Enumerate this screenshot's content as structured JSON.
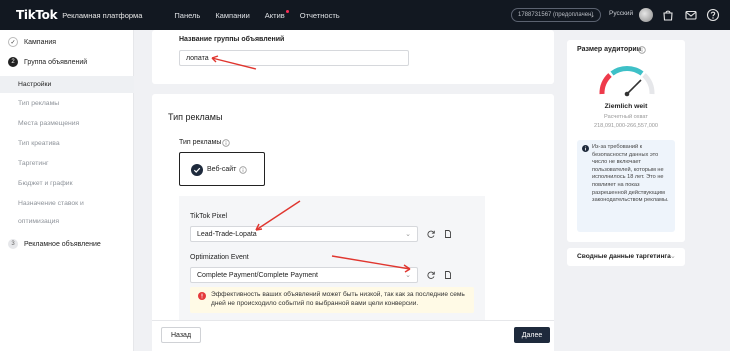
{
  "topbar": {
    "logo": "TikTok",
    "logo_sub": "Рекламная платформа",
    "nav": [
      "Панель",
      "Кампании",
      "Актив",
      "Отчетность"
    ],
    "account": "1788731567 (предоплачен)",
    "language": "Русский",
    "icons": [
      "avatar",
      "store-icon",
      "mail-icon",
      "help-icon"
    ]
  },
  "sidebar": {
    "campaign": "Кампания",
    "step2_num": "2",
    "ad_group": "Группа объявлений",
    "sub_items": [
      "Настройки",
      "Тип рекламы",
      "Места размещения",
      "Тип креатива",
      "Таргетинг",
      "Бюджет и график",
      "Назначение ставок и",
      "оптимизация"
    ],
    "step3_num": "3",
    "ad": "Рекламное объявление"
  },
  "name_section": {
    "label": "Название группы объявлений",
    "value": "лопата"
  },
  "ad_type_section": {
    "title": "Тип рекламы",
    "label": "Тип рекламы",
    "option": "Веб-сайт",
    "pixel_label": "TikTok Pixel",
    "pixel_value": "Lead-Trade-Lopata",
    "event_label": "Optimization Event",
    "event_value": "Complete Payment/Complete Payment",
    "warning": "Эффективность ваших объявлений может быть низкой, так как за последние семь дней не происходило событий по выбранной вами цели конверсии."
  },
  "footer": {
    "back": "Назад",
    "next": "Далее"
  },
  "audience": {
    "title": "Размер аудитории",
    "gauge_label": "Ziemlich weit",
    "estimate_label": "Расчетный охват",
    "estimate_value": "218,091,000-266,557,000",
    "info": "Из-за требований к безопасности данных это число не включает пользователей, которым не исполнилось 18 лет. Это не повлияет на показ разрешенной действующим законодательством рекламы.",
    "summary": "Сводные данные таргетинга"
  },
  "colors": {
    "topbar_bg": "#121821",
    "accent": "#fe2c55",
    "primary_btn": "#1e2a3c",
    "gauge_red": "#ee3a4b",
    "gauge_teal": "#3ec0c7",
    "arrow": "#e0362f"
  }
}
